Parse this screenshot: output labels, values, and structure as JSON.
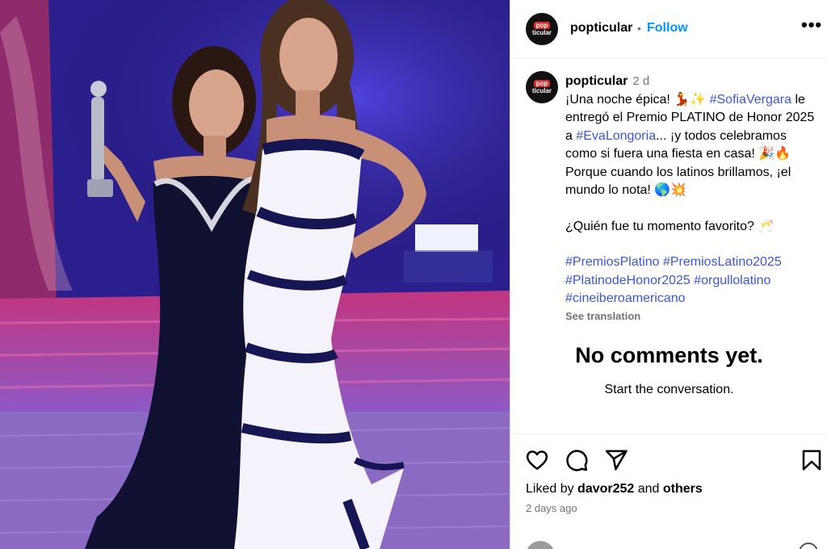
{
  "post": {
    "username": "popticular",
    "follow_label": "Follow",
    "dot": "•",
    "more_label": "•••",
    "avatar_text_top": "pop",
    "avatar_text_bottom": "ticular"
  },
  "caption": {
    "username": "popticular",
    "time": "2 d",
    "line1_pre": "¡Una noche épica! 💃✨ ",
    "tag_sofia": "#SofiaVergara",
    "line1_post": " le entregó el Premio PLATINO de Honor 2025 a ",
    "tag_eva": "#EvaLongoria",
    "line2": "... ¡y todos celebramos como si fuera una fiesta en casa! 🎉🔥 Porque cuando los latinos brillamos, ¡el mundo lo nota! 🌎💥",
    "question": "¿Quién fue tu momento favorito? 🥂",
    "hashtags": [
      "#PremiosPlatino",
      "#PremiosLatino2025",
      "#PlatinodeHonor2025",
      "#orgullolatino",
      "#cineiberoamericano"
    ],
    "see_translation": "See translation"
  },
  "comments": {
    "empty_title": "No comments yet.",
    "empty_sub": "Start the conversation."
  },
  "actions": {
    "liked_by_prefix": "Liked by ",
    "liked_by_user": "davor252",
    "liked_by_mid": " and ",
    "liked_by_others": "others",
    "time_ago": "2 days ago",
    "icons": [
      "heart-icon",
      "comment-icon",
      "share-icon",
      "bookmark-icon"
    ]
  },
  "colors": {
    "follow": "#0095f6",
    "hashtag": "#3b57d9",
    "muted": "#737373"
  }
}
